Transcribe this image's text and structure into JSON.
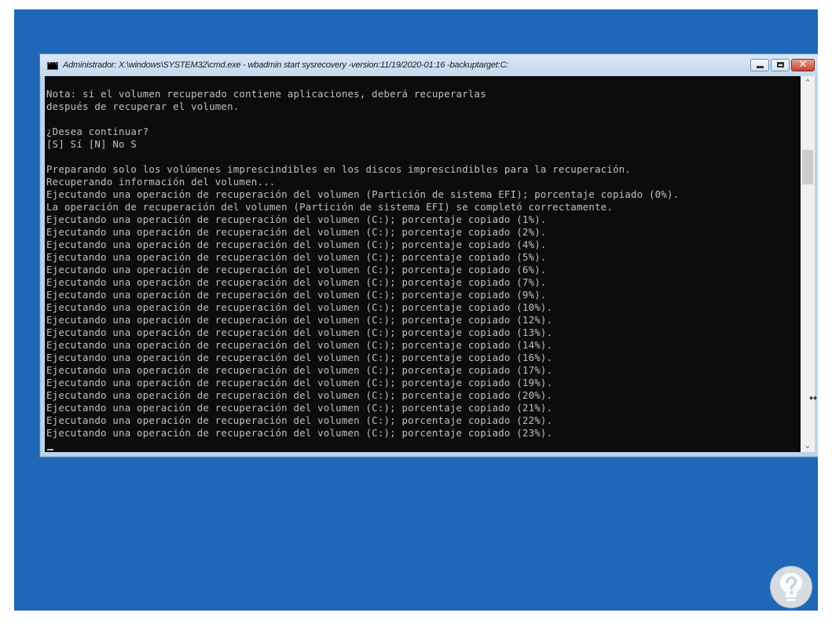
{
  "window": {
    "title": "Administrador: X:\\windows\\SYSTEM32\\cmd.exe - wbadmin  start sysrecovery -version:11/19/2020-01:16 -backuptarget:C:"
  },
  "console": {
    "lines": [
      "Nota: si el volumen recuperado contiene aplicaciones, deberá recuperarlas",
      "después de recuperar el volumen.",
      "",
      "¿Desea continuar?",
      "[S] Sí [N] No S",
      "",
      "Preparando solo los volúmenes imprescindibles en los discos imprescindibles para la recuperación.",
      "Recuperando información del volumen...",
      "Ejecutando una operación de recuperación del volumen (Partición de sistema EFI); porcentaje copiado (0%).",
      "La operación de recuperación del volumen (Partición de sistema EFI) se completó correctamente.",
      "Ejecutando una operación de recuperación del volumen (C:); porcentaje copiado (1%).",
      "Ejecutando una operación de recuperación del volumen (C:); porcentaje copiado (2%).",
      "Ejecutando una operación de recuperación del volumen (C:); porcentaje copiado (4%).",
      "Ejecutando una operación de recuperación del volumen (C:); porcentaje copiado (5%).",
      "Ejecutando una operación de recuperación del volumen (C:); porcentaje copiado (6%).",
      "Ejecutando una operación de recuperación del volumen (C:); porcentaje copiado (7%).",
      "Ejecutando una operación de recuperación del volumen (C:); porcentaje copiado (9%).",
      "Ejecutando una operación de recuperación del volumen (C:); porcentaje copiado (10%).",
      "Ejecutando una operación de recuperación del volumen (C:); porcentaje copiado (12%).",
      "Ejecutando una operación de recuperación del volumen (C:); porcentaje copiado (13%).",
      "Ejecutando una operación de recuperación del volumen (C:); porcentaje copiado (14%).",
      "Ejecutando una operación de recuperación del volumen (C:); porcentaje copiado (16%).",
      "Ejecutando una operación de recuperación del volumen (C:); porcentaje copiado (17%).",
      "Ejecutando una operación de recuperación del volumen (C:); porcentaje copiado (19%).",
      "Ejecutando una operación de recuperación del volumen (C:); porcentaje copiado (20%).",
      "Ejecutando una operación de recuperación del volumen (C:); porcentaje copiado (21%).",
      "Ejecutando una operación de recuperación del volumen (C:); porcentaje copiado (22%).",
      "Ejecutando una operación de recuperación del volumen (C:); porcentaje copiado (23%)."
    ]
  },
  "icons": {
    "window_icon": "cmd-icon",
    "minimize": "minimize-icon",
    "maximize": "maximize-icon",
    "close": "close-icon",
    "scroll_up": "chevron-up-icon",
    "scroll_down": "chevron-down-icon",
    "cursor": "resize-horizontal-cursor-icon",
    "watermark": "help-question-logo"
  },
  "colors": {
    "desktop": "#1f68b8",
    "console_bg": "#0c0c0c",
    "console_fg": "#c0c0c0",
    "close_button": "#c5432a"
  }
}
